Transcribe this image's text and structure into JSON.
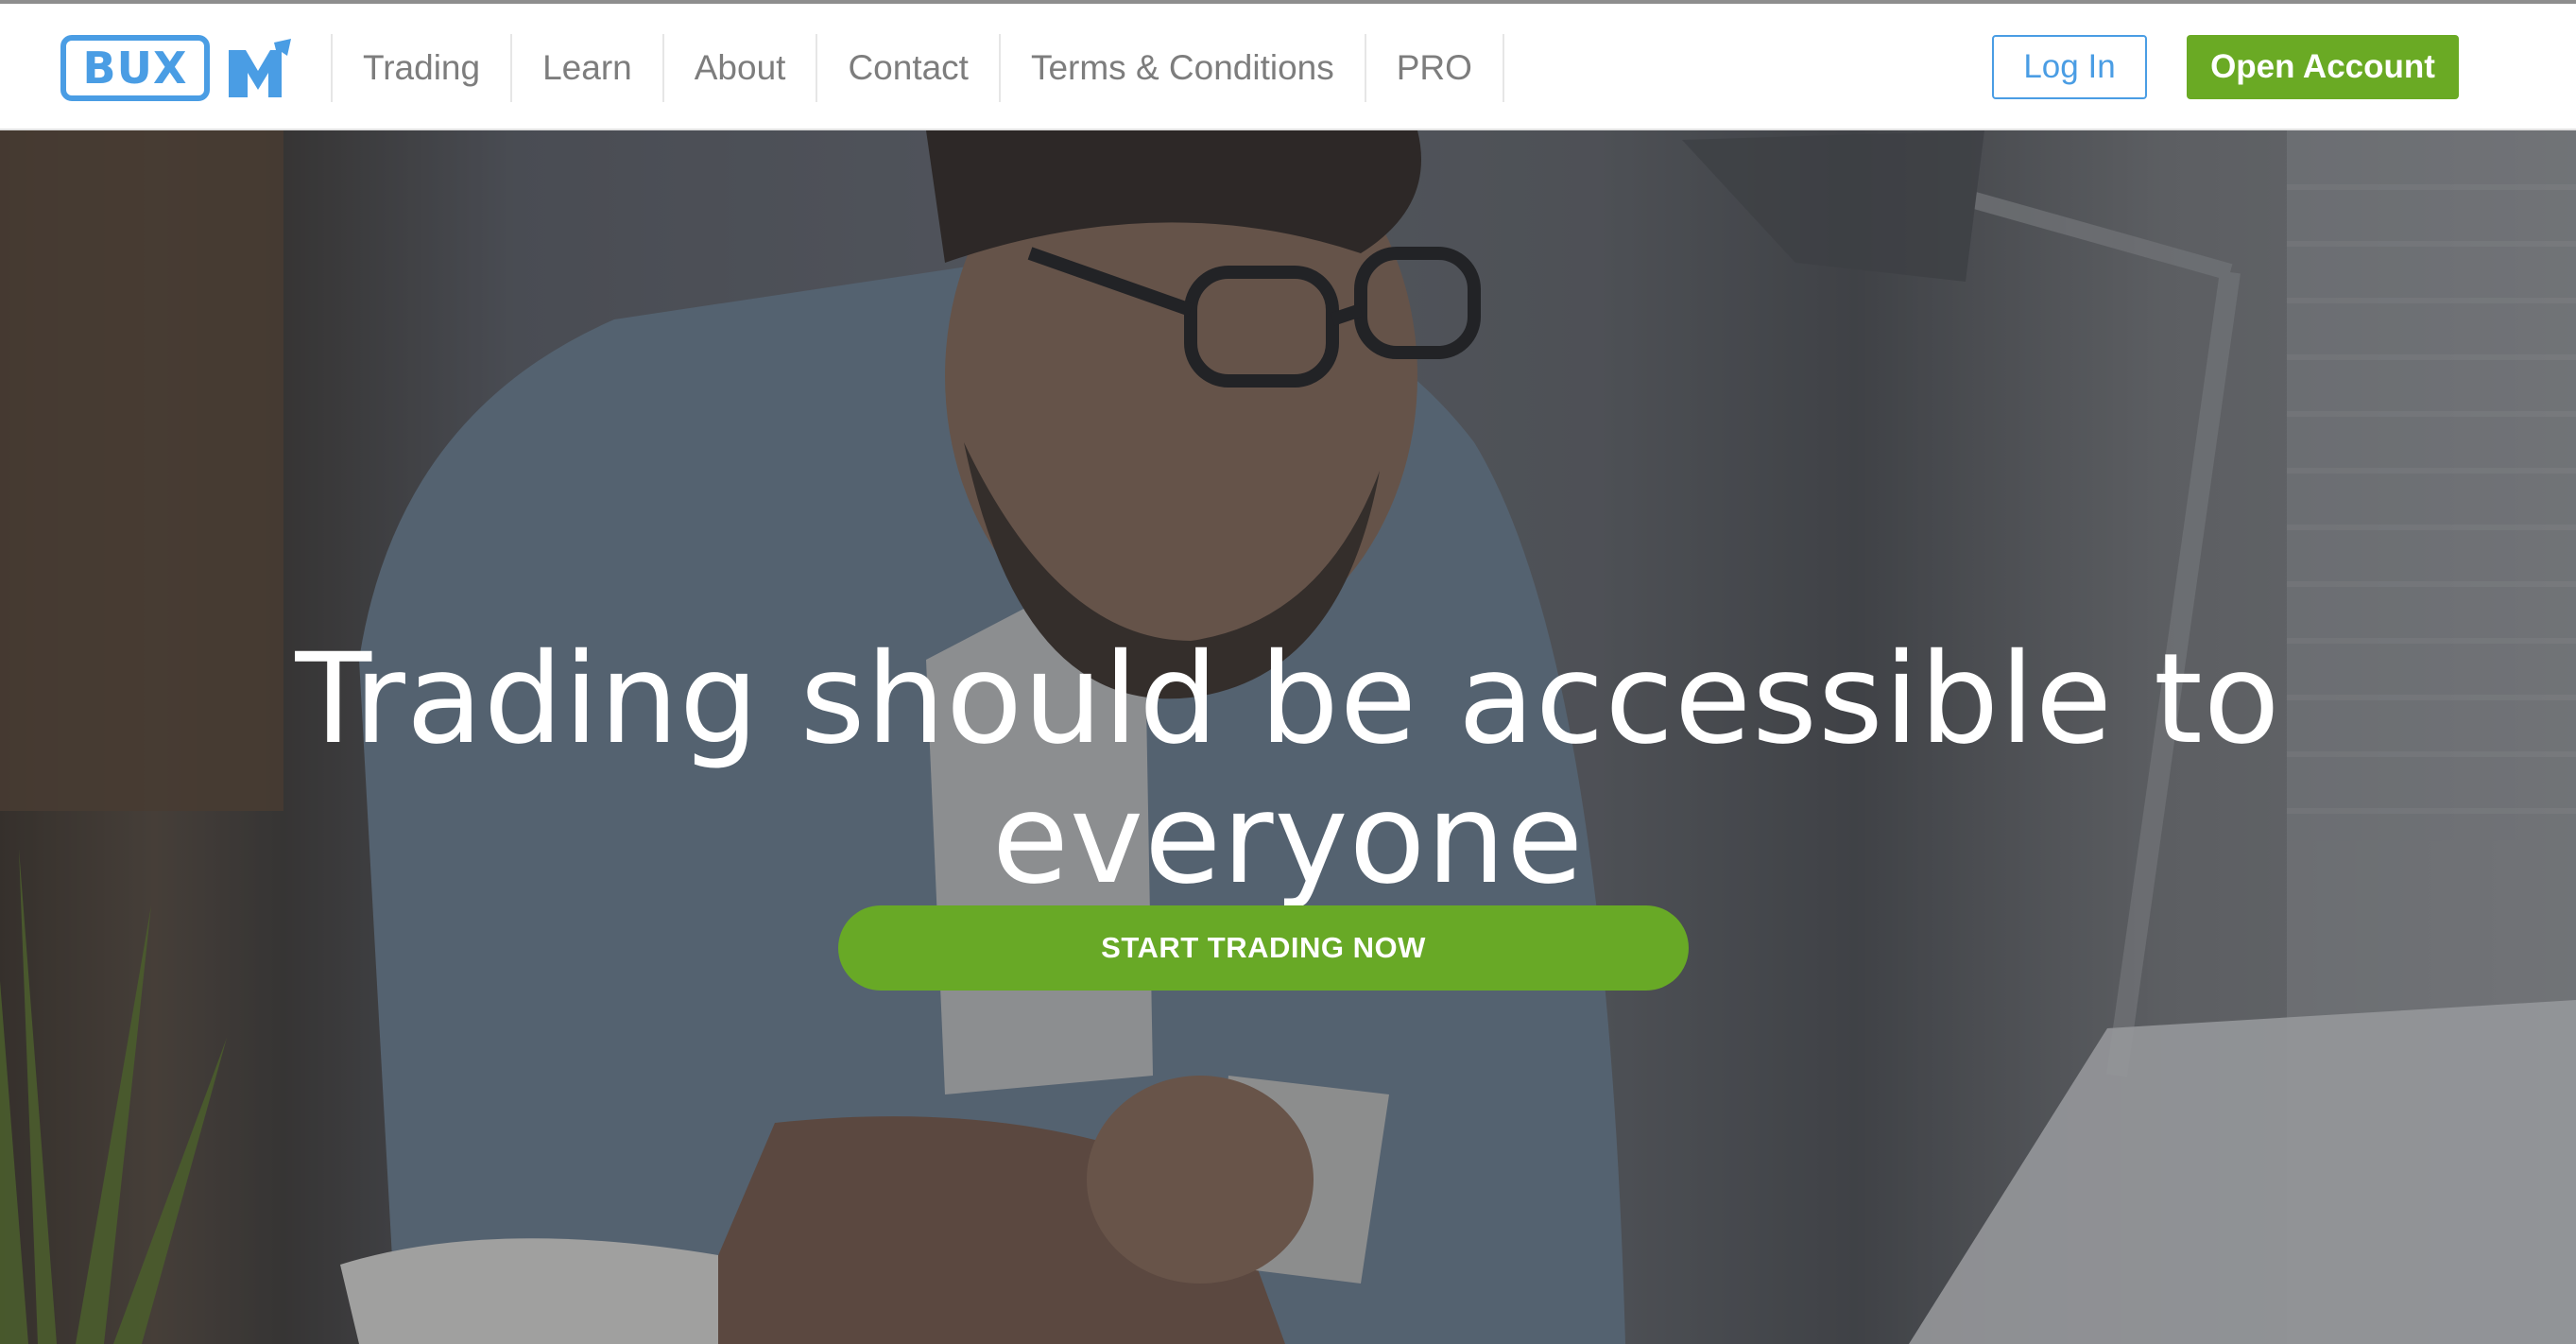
{
  "brand": {
    "logo_text": "BUX",
    "logo_mark": "M",
    "primary_color": "#4a9de4",
    "accent_color": "#6aaa24"
  },
  "nav": {
    "links": [
      {
        "label": "Trading"
      },
      {
        "label": "Learn"
      },
      {
        "label": "About"
      },
      {
        "label": "Contact"
      },
      {
        "label": "Terms & Conditions"
      },
      {
        "label": "PRO"
      }
    ],
    "login_label": "Log In",
    "open_account_label": "Open Account"
  },
  "hero": {
    "headline_line1": "Trading should be accessible to",
    "headline_line2": "everyone",
    "cta_label": "START TRADING NOW",
    "background_image": "man-with-smartphone-photo"
  }
}
